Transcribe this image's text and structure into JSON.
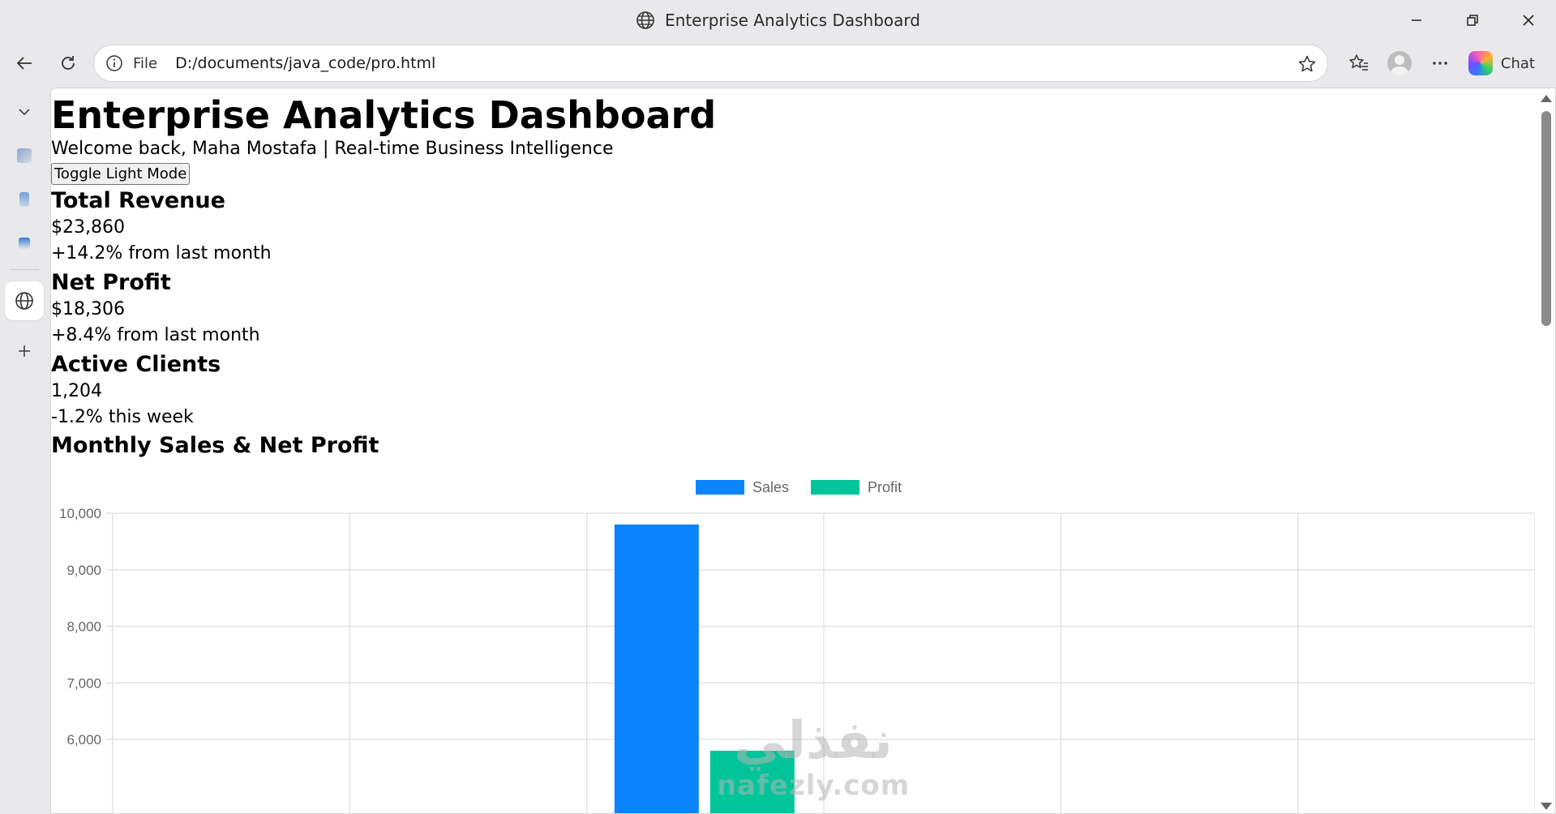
{
  "window": {
    "title": "Enterprise Analytics Dashboard",
    "minimize_icon": "minimize-icon",
    "restore_icon": "restore-icon",
    "close_icon": "close-icon"
  },
  "toolbar": {
    "scheme_label": "File",
    "url": "D:/documents/java_code/pro.html",
    "chat_label": "Chat"
  },
  "page": {
    "heading": "Enterprise Analytics Dashboard",
    "subtitle": "Welcome back, Maha Mostafa | Real-time Business Intelligence",
    "toggle_label": "Toggle Light Mode",
    "metrics": [
      {
        "title": "Total Revenue",
        "value": "$23,860",
        "change": "+14.2% from last month"
      },
      {
        "title": "Net Profit",
        "value": "$18,306",
        "change": "+8.4% from last month"
      },
      {
        "title": "Active Clients",
        "value": "1,204",
        "change": "-1.2% this week"
      }
    ],
    "chart_heading": "Monthly Sales & Net Profit"
  },
  "chart_data": {
    "type": "bar",
    "title": "Monthly Sales & Net Profit",
    "categories": [
      "",
      "",
      "",
      "",
      "",
      ""
    ],
    "series": [
      {
        "name": "Sales",
        "color": "#0a84ff",
        "values": [
          null,
          null,
          9800,
          null,
          null,
          null
        ]
      },
      {
        "name": "Profit",
        "color": "#00c49a",
        "values": [
          null,
          null,
          5800,
          null,
          null,
          null
        ]
      }
    ],
    "y_ticks": [
      "10,000",
      "9,000",
      "8,000",
      "7,000",
      "6,000"
    ],
    "ylim": [
      5400,
      10000
    ],
    "legend": "top-center",
    "grid": true
  },
  "watermark": {
    "arabic": "نفذلي",
    "latin": "nafezly.com"
  }
}
